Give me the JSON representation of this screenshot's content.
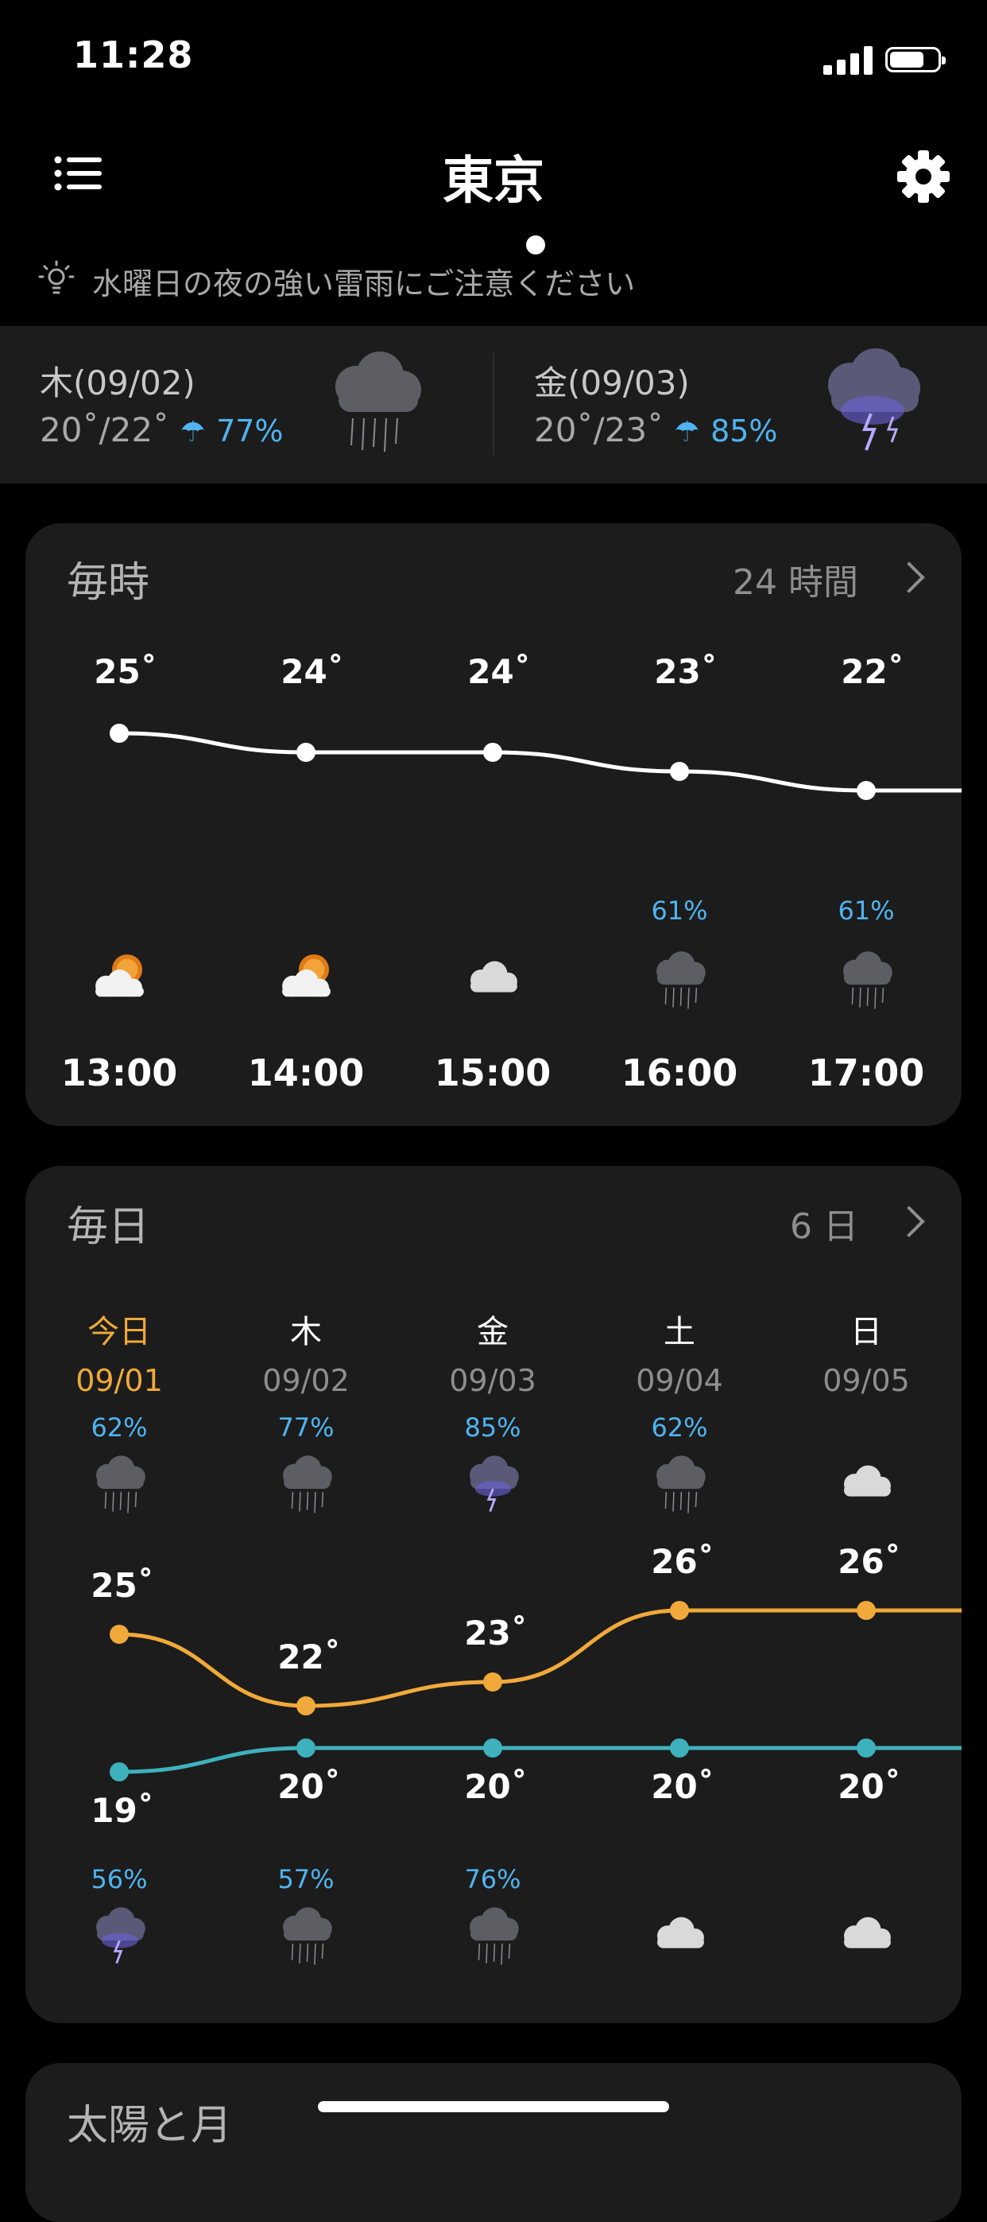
{
  "status_bar": {
    "time": "11:28"
  },
  "header": {
    "title": "東京"
  },
  "alert": {
    "text": "水曜日の夜の強い雷雨にご注意ください"
  },
  "strip": [
    {
      "day": "木(09/02)",
      "low": "20˚",
      "high": "22˚",
      "pop": "77%",
      "icon": "rain-cloud-icon"
    },
    {
      "day": "金(09/03)",
      "low": "20˚",
      "high": "23˚",
      "pop": "85%",
      "icon": "thunderstorm-icon"
    }
  ],
  "hourly": {
    "title": "毎時",
    "link_label": "24 時間",
    "items": [
      {
        "time": "13:00",
        "temp": "25˚",
        "pop": "",
        "icon": "partly-sunny-icon",
        "value": 25
      },
      {
        "time": "14:00",
        "temp": "24˚",
        "pop": "",
        "icon": "partly-sunny-icon",
        "value": 24
      },
      {
        "time": "15:00",
        "temp": "24˚",
        "pop": "",
        "icon": "cloud-icon",
        "value": 24
      },
      {
        "time": "16:00",
        "temp": "23˚",
        "pop": "61%",
        "icon": "rain-cloud-icon",
        "value": 23
      },
      {
        "time": "17:00",
        "temp": "22˚",
        "pop": "61%",
        "icon": "rain-cloud-icon",
        "value": 22
      }
    ]
  },
  "daily": {
    "title": "毎日",
    "link_label": "6 日",
    "items": [
      {
        "name": "今日",
        "date": "09/01",
        "day_pop": "62%",
        "day_icon": "rain-cloud-icon",
        "high": "25˚",
        "high_value": 25,
        "low": "19˚",
        "low_value": 19,
        "night_pop": "56%",
        "night_icon": "thunderstorm-icon"
      },
      {
        "name": "木",
        "date": "09/02",
        "day_pop": "77%",
        "day_icon": "rain-cloud-icon",
        "high": "22˚",
        "high_value": 22,
        "low": "20˚",
        "low_value": 20,
        "night_pop": "57%",
        "night_icon": "rain-cloud-icon"
      },
      {
        "name": "金",
        "date": "09/03",
        "day_pop": "85%",
        "day_icon": "thunderstorm-icon",
        "high": "23˚",
        "high_value": 23,
        "low": "20˚",
        "low_value": 20,
        "night_pop": "76%",
        "night_icon": "rain-cloud-icon"
      },
      {
        "name": "土",
        "date": "09/04",
        "day_pop": "62%",
        "day_icon": "rain-cloud-icon",
        "high": "26˚",
        "high_value": 26,
        "low": "20˚",
        "low_value": 20,
        "night_pop": "",
        "night_icon": "cloud-icon"
      },
      {
        "name": "日",
        "date": "09/05",
        "day_pop": "",
        "day_icon": "cloud-icon",
        "high": "26˚",
        "high_value": 26,
        "low": "20˚",
        "low_value": 20,
        "night_pop": "",
        "night_icon": "cloud-icon"
      }
    ]
  },
  "sun_moon": {
    "title": "太陽と月"
  },
  "colors": {
    "accent_today": "#f0a93a",
    "high_line": "#f0a93a",
    "low_line": "#3fb1bd",
    "precip": "#4fb4f0"
  }
}
